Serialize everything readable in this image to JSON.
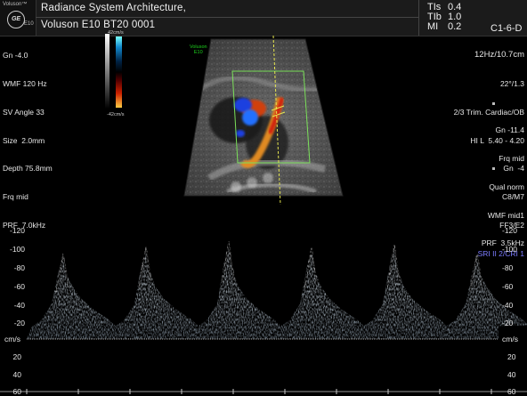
{
  "header": {
    "brand": "Voluson™",
    "logo": "GE",
    "model_small": "E10",
    "title_line1": "Radiance System Architecture,",
    "title_line2": "Voluson E10 BT20 0001",
    "indices": [
      {
        "label": "TIs",
        "value": "0.4"
      },
      {
        "label": "TIb",
        "value": "1.0"
      },
      {
        "label": "MI",
        "value": "0.2"
      }
    ],
    "probe": "C1-6-D"
  },
  "left_params": [
    "Gn -4.0",
    "WMF 120 Hz",
    "SV Angle 33",
    "Size  2.0mm",
    "Depth 75.8mm",
    "Frq mid",
    "PRF  7.0kHz"
  ],
  "colorbar": {
    "top": "42cm/s",
    "bottom": "-42cm/s"
  },
  "right_params": [
    "12Hz/10.7cm",
    "22°/1.3",
    "2/3 Trim. Cardiac/OB",
    "HI L  5.40 - 4.20",
    "Gn  -4",
    "C8/M7",
    "FF3/E2",
    "SRI II 2/CRI 1"
  ],
  "right_params2": [
    "Gn -11.4",
    "Frq mid",
    "Qual norm",
    "WMF mid1",
    "PRF  3.5kHz"
  ],
  "image_tag": {
    "line1": "Voluson",
    "line2": "E10"
  },
  "doppler": {
    "unit": "cm/s",
    "ticks_neg": [
      "-120",
      "-100",
      "-80",
      "-60",
      "-40",
      "-20"
    ],
    "ticks_pos": [
      "20",
      "40",
      "60"
    ],
    "peaks": [
      -93,
      -100,
      -106,
      -99,
      -102,
      -93
    ]
  },
  "colors": {
    "roi_box": "#7be05a",
    "cursor": "#e8e850",
    "blue_param": "#7c7cff"
  }
}
